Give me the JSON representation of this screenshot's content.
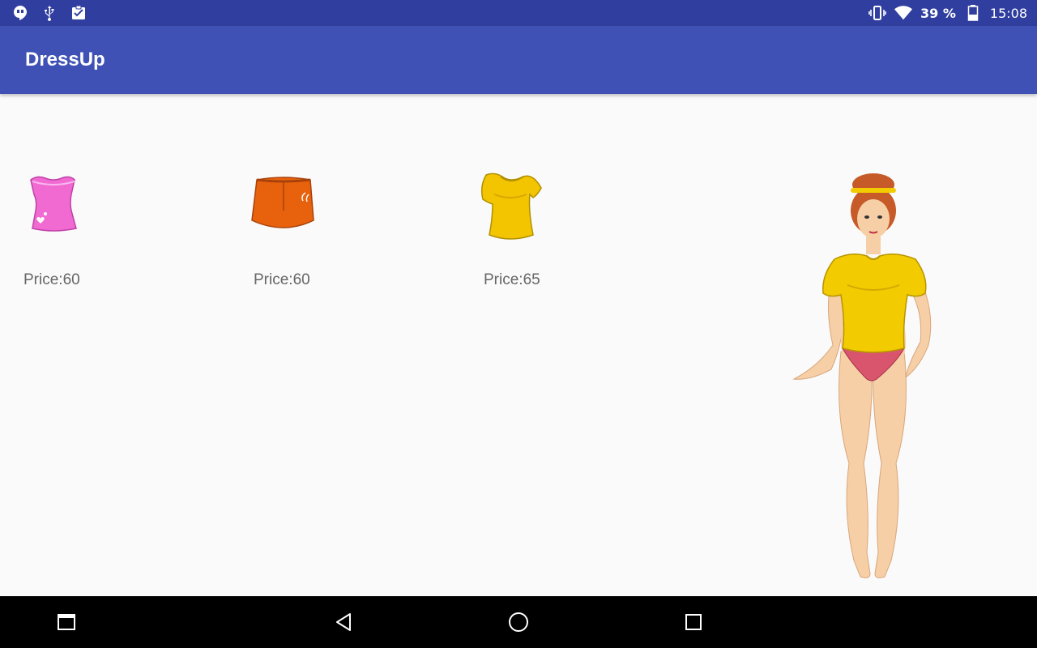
{
  "status_bar": {
    "icons_left": [
      "hangouts-icon",
      "usb-icon",
      "clipboard-check-icon"
    ],
    "icons_right": [
      "vibrate-icon",
      "wifi-icon",
      "battery-icon"
    ],
    "battery_text": "39 %",
    "time": "15:08"
  },
  "app_bar": {
    "title": "DressUp"
  },
  "items": [
    {
      "name": "pink-top",
      "price": "Price:60",
      "color": "#f06ad2"
    },
    {
      "name": "orange-skirt",
      "price": "Price:60",
      "color": "#e8620e"
    },
    {
      "name": "yellow-tshirt",
      "price": "Price:65",
      "color": "#f2c500"
    }
  ],
  "model": {
    "top_color": "#f2cc00",
    "bottom_color": "#d9556e",
    "skin_color": "#f6cfa6",
    "hair_color": "#c65a28"
  },
  "nav_bar": {
    "buttons": [
      "recents-app-icon",
      "back-icon",
      "home-icon",
      "overview-icon"
    ]
  },
  "colors": {
    "status_bar": "#303f9f",
    "app_bar": "#3f51b5",
    "background": "#fafafa",
    "nav_bar": "#000000"
  }
}
